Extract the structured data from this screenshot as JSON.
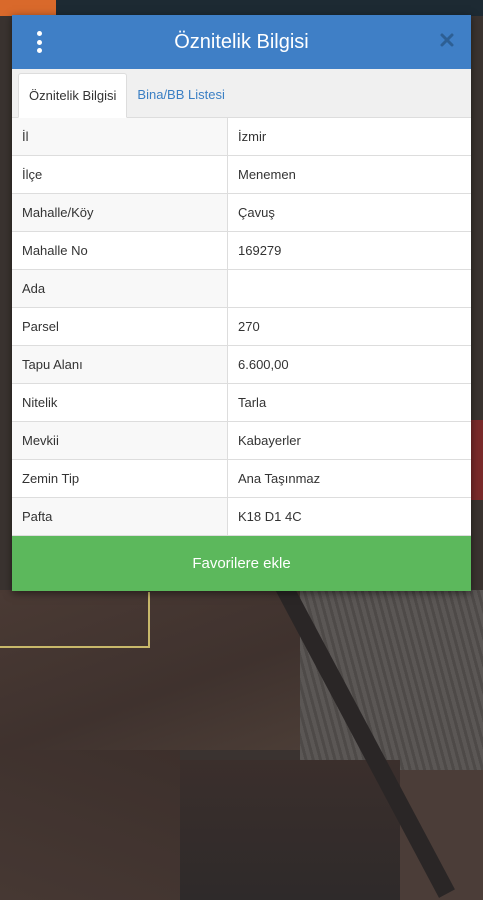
{
  "dialog": {
    "title": "Öznitelik Bilgisi",
    "menu_icon": "more-vertical-icon",
    "close_icon": "close-icon"
  },
  "tabs": [
    {
      "label": "Öznitelik Bilgisi",
      "active": true
    },
    {
      "label": "Bina/BB Listesi",
      "active": false
    }
  ],
  "attributes": [
    {
      "key": "İl",
      "value": "İzmir"
    },
    {
      "key": "İlçe",
      "value": "Menemen"
    },
    {
      "key": "Mahalle/Köy",
      "value": "Çavuş"
    },
    {
      "key": "Mahalle No",
      "value": "169279"
    },
    {
      "key": "Ada",
      "value": ""
    },
    {
      "key": "Parsel",
      "value": "270"
    },
    {
      "key": "Tapu Alanı",
      "value": "6.600,00"
    },
    {
      "key": "Nitelik",
      "value": "Tarla"
    },
    {
      "key": "Mevkii",
      "value": "Kabayerler"
    },
    {
      "key": "Zemin Tip",
      "value": "Ana Taşınmaz"
    },
    {
      "key": "Pafta",
      "value": "K18 D1 4C"
    }
  ],
  "actions": {
    "favorite_label": "Favorilere ekle"
  },
  "colors": {
    "header": "#3f7fc6",
    "tab_link": "#3a7fc4",
    "button": "#5cb85c"
  }
}
